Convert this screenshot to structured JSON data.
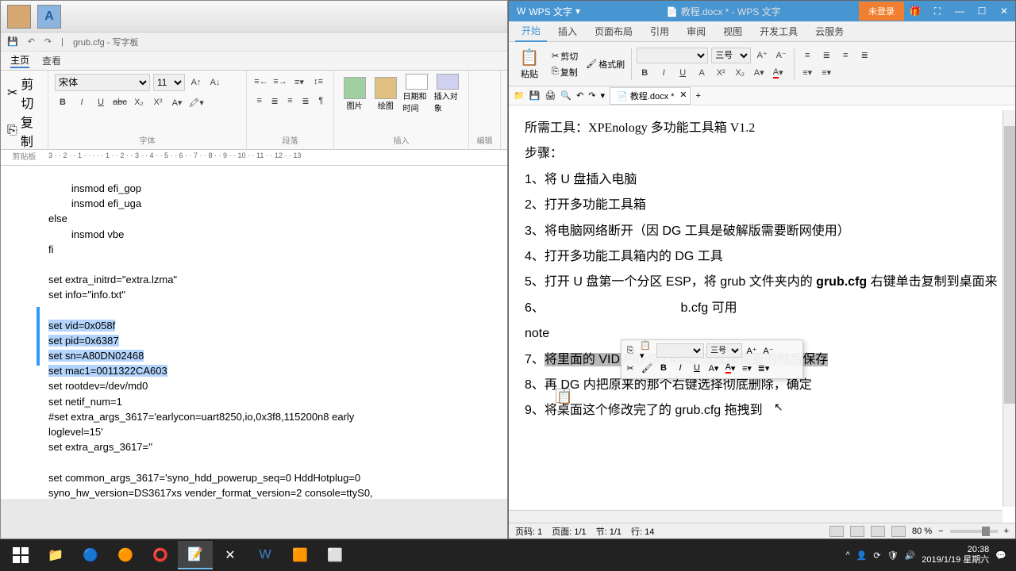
{
  "left": {
    "filename": "grub.cfg - 写字板",
    "tabs": {
      "main": "主页",
      "view": "查看"
    },
    "ribbon": {
      "clipboard": {
        "cut": "剪切",
        "copy": "复制",
        "paste": "粘贴",
        "label": "剪贴板"
      },
      "font": {
        "name": "宋体",
        "size": "11",
        "label": "字体"
      },
      "paragraph_label": "段落",
      "insert": {
        "picture": "图片",
        "paint": "绘图",
        "datetime": "日期和时间",
        "object": "插入对象",
        "label": "插入"
      },
      "edit_label": "编辑"
    },
    "ruler": "3 · · 2 · · 1 · · · · · 1 · · 2 · · 3 · · 4 · · 5 · · 6 · · 7 · · 8 · · 9 · · 10 · · 11 · · 12 · · 13",
    "code": {
      "l1": "        insmod efi_gop",
      "l2": "        insmod efi_uga",
      "l3": "else",
      "l4": "        insmod vbe",
      "l5": "fi",
      "l6": "",
      "l7": "set extra_initrd=\"extra.lzma\"",
      "l8": "set info=\"info.txt\"",
      "l9": "",
      "l10": "set vid=0x058f",
      "l11": "set pid=0x6387",
      "l12": "set sn=A80DN02468",
      "l13": "set mac1=0011322CA603",
      "l14": "set rootdev=/dev/md0",
      "l15": "set netif_num=1",
      "l16": "#set extra_args_3617='earlycon=uart8250,io,0x3f8,115200n8 early",
      "l17": "loglevel=15'",
      "l18": "set extra_args_3617=''",
      "l19": "",
      "l20": "set common_args_3617='syno_hdd_powerup_seq=0 HddHotplug=0",
      "l21": "syno_hw_version=DS3617xs vender_format_version=2 console=ttyS0,"
    }
  },
  "right": {
    "app_name": "WPS 文字",
    "doc_title": "教程.docx * - WPS 文字",
    "login": "未登录",
    "tabs": [
      "开始",
      "插入",
      "页面布局",
      "引用",
      "审阅",
      "视图",
      "开发工具",
      "云服务"
    ],
    "active_tab": "开始",
    "ribbon": {
      "paste": "粘贴",
      "cut": "剪切",
      "copy": "复制",
      "format_painter": "格式刷",
      "font_size": "三号"
    },
    "doctab": "教程.docx *",
    "content": {
      "tools": "所需工具：",
      "tool_name": "XPEnology 多功能工具箱 V1.2",
      "steps_label": "步骤：",
      "s1": "1、将 U 盘插入电脑",
      "s2": "2、打开多功能工具箱",
      "s3": "3、将电脑网络断开（因 DG 工具是破解版需要断网使用）",
      "s4": "4、打开多功能工具箱内的 DG 工具",
      "s5": "5、打开 U 盘第一个分区 ESP，将 grub 文件夹内的 ",
      "s5b": "grub.cfg",
      "s5c": " 右键单击复制到桌面来",
      "s6a": "6、",
      "s6b": "b.cfg 可用",
      "s6c": "note",
      "s7a": "7、",
      "s7b": "将里面的 VID PID SN MAC 改成你需要的然后保存",
      "s8": "8、再 DG 内把原来的那个右键选择彻底删除，确定",
      "s9a": "9、将桌面这个修改完了的 ",
      "s9b": "grub.cfg",
      "s9c": " 拖拽到"
    },
    "mini_toolbar": {
      "font_size": "三号"
    },
    "status": {
      "page": "页码: 1",
      "page_of": "页面: 1/1",
      "section": "节: 1/1",
      "line": "行: 14",
      "zoom": "80 %"
    }
  },
  "taskbar": {
    "time": "20:38",
    "date": "2019/1/19 星期六"
  }
}
